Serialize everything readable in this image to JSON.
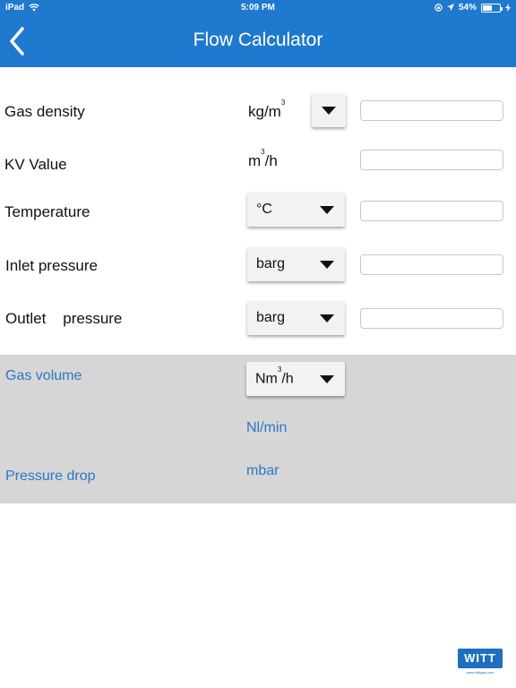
{
  "status_bar": {
    "device": "iPad",
    "time": "5:09 PM",
    "battery": "54%",
    "battery_level": 0.54
  },
  "header": {
    "title": "Flow Calculator",
    "back_icon": "chevron-left-icon"
  },
  "rows": {
    "gas_density": {
      "label": "Gas density",
      "unit_base": "kg/m",
      "unit_sup": "3",
      "value": ""
    },
    "kv_value": {
      "label": "KV Value",
      "unit_base": "m",
      "unit_sup": "3",
      "unit_suffix": "/h",
      "value": ""
    },
    "temperature": {
      "label": "Temperature",
      "selected": "°C",
      "value": ""
    },
    "inlet_pressure": {
      "label": "Inlet pressure",
      "selected": "barg",
      "value": ""
    },
    "outlet_pressure": {
      "label": "Outlet    pressure",
      "selected": "barg",
      "value": ""
    }
  },
  "results": {
    "gas_volume": {
      "label": "Gas volume",
      "selected_base": "Nm",
      "selected_sup": "3",
      "selected_suffix": "/h",
      "alt_unit": "Nl/min"
    },
    "pressure_drop": {
      "label": "Pressure drop",
      "unit": "mbar"
    }
  },
  "logo": {
    "text": "WITT",
    "url": "www.wittgas.com"
  },
  "colors": {
    "header": "#1f79cf",
    "results_bg": "#d6d6d6",
    "result_text": "#2a78c4"
  }
}
